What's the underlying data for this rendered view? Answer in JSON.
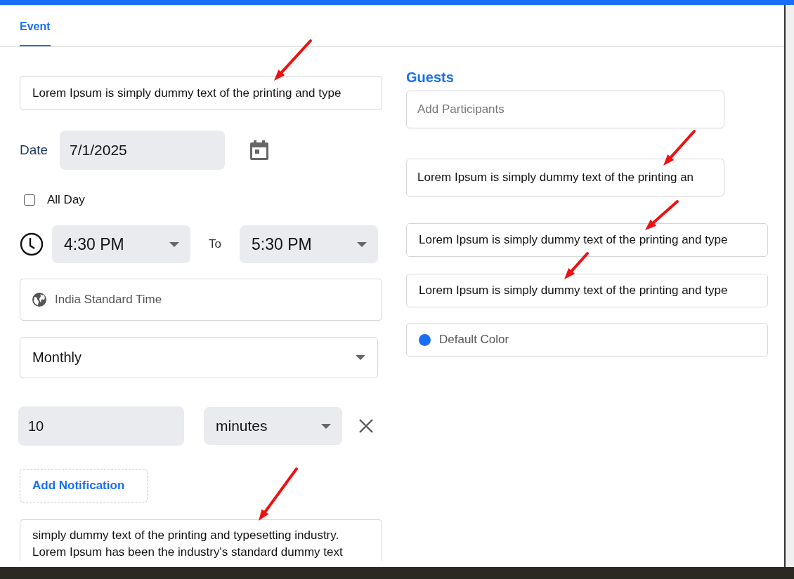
{
  "tabs": [
    {
      "label": "Event",
      "selected": true
    }
  ],
  "title_field": {
    "value": "Lorem Ipsum is simply dummy text of the printing and type"
  },
  "date": {
    "label": "Date",
    "value": "7/1/2025"
  },
  "all_day": {
    "label": "All Day",
    "checked": false
  },
  "time": {
    "start": "4:30 PM",
    "separator": "To",
    "end": "5:30 PM"
  },
  "timezone": {
    "value": "India Standard Time"
  },
  "recurrence": {
    "value": "Monthly"
  },
  "notification": {
    "amount": "10",
    "unit": "minutes"
  },
  "add_notification_button": "Add Notification",
  "description": {
    "value": "simply dummy text of the printing and typesetting industry. Lorem Ipsum has been the industry's standard dummy text"
  },
  "guests": {
    "heading": "Guests",
    "placeholder": "Add Participants",
    "fields": [
      {
        "value": "Lorem Ipsum is simply dummy text of the printing an"
      },
      {
        "value": "Lorem Ipsum is simply dummy text of the printing and type"
      },
      {
        "value": "Lorem Ipsum is simply dummy text of the printing and type"
      }
    ]
  },
  "color": {
    "label": "Default Color",
    "color": "#1a6ef5"
  }
}
